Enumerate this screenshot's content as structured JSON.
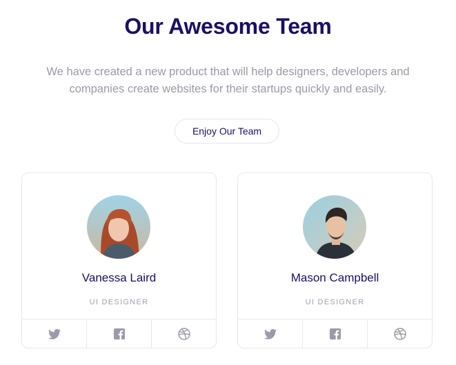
{
  "header": {
    "title": "Our Awesome Team",
    "subtitle": "We have created a new product that will help designers, developers and companies create websites for their startups quickly and easily.",
    "cta_label": "Enjoy Our Team"
  },
  "team": [
    {
      "name": "Vanessa Laird",
      "role": "UI DESIGNER",
      "socials": [
        "twitter-icon",
        "facebook-icon",
        "dribbble-icon"
      ]
    },
    {
      "name": "Mason Campbell",
      "role": "UI DESIGNER",
      "socials": [
        "twitter-icon",
        "facebook-icon",
        "dribbble-icon"
      ]
    }
  ],
  "colors": {
    "heading": "#1c0f63",
    "muted": "#9a9aa8",
    "icon": "#9a9aa8",
    "border": "#e8e8ee"
  }
}
